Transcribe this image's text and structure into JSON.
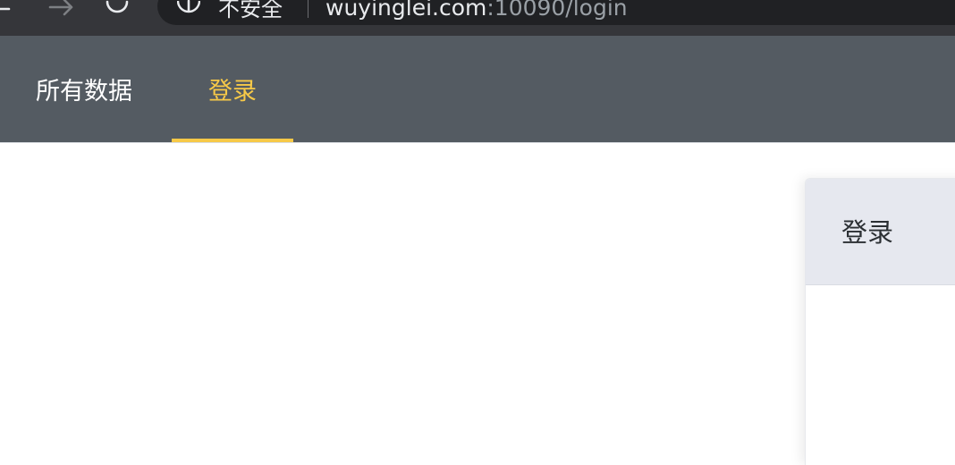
{
  "browser": {
    "security_label": "不安全",
    "url_host": "wuyinglei.com",
    "url_rest": ":10090/login",
    "icons": {
      "back": "back-arrow-icon",
      "forward": "forward-arrow-icon",
      "reload": "reload-icon",
      "info": "info-circle-icon"
    }
  },
  "nav": {
    "tabs": [
      {
        "label": "所有数据",
        "active": false
      },
      {
        "label": "登录",
        "active": true
      }
    ],
    "active_color": "#f7c948",
    "background": "#545b62"
  },
  "login_card": {
    "title": "登录"
  }
}
